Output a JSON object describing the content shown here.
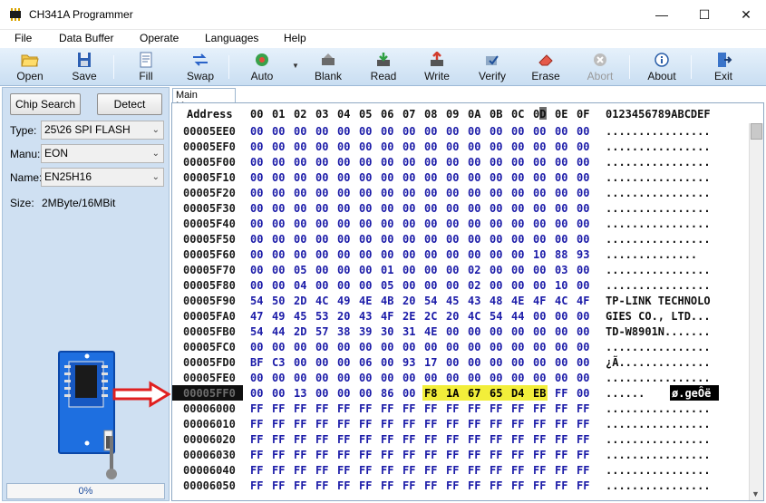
{
  "window": {
    "title": "CH341A Programmer",
    "minimize_glyph": "—",
    "maximize_glyph": "☐",
    "close_glyph": "✕"
  },
  "menu": [
    "File",
    "Data Buffer",
    "Operate",
    "Languages",
    "Help"
  ],
  "toolbar": {
    "open": "Open",
    "save": "Save",
    "fill": "Fill",
    "swap": "Swap",
    "auto": "Auto",
    "blank": "Blank",
    "read": "Read",
    "write": "Write",
    "verify": "Verify",
    "erase": "Erase",
    "abort": "Abort",
    "about": "About",
    "exit": "Exit",
    "dropdown_glyph": "▼"
  },
  "chip_panel": {
    "chip_search": "Chip Search",
    "detect": "Detect",
    "type_label": "Type:",
    "type_value": "25\\26 SPI FLASH",
    "manu_label": "Manu:",
    "manu_value": "EON",
    "name_label": "Name:",
    "name_value": "EN25H16",
    "size_label": "Size:",
    "size_value": "2MByte/16MBit",
    "progress": "0%",
    "combo_arrow": "⌄"
  },
  "memory": {
    "tab": "Main Memory",
    "header_address": "Address",
    "header_cols": [
      "00",
      "01",
      "02",
      "03",
      "04",
      "05",
      "06",
      "07",
      "08",
      "09",
      "0A",
      "0B",
      "0C",
      "0D",
      "0E",
      "0F"
    ],
    "header_ascii": "0123456789ABCDEF",
    "selected_highlight_ascii": "ø.geÔë",
    "rows": [
      {
        "addr": "00005EE0",
        "bytes": [
          "00",
          "00",
          "00",
          "00",
          "00",
          "00",
          "00",
          "00",
          "00",
          "00",
          "00",
          "00",
          "00",
          "00",
          "00",
          "00"
        ],
        "ascii": "................"
      },
      {
        "addr": "00005EF0",
        "bytes": [
          "00",
          "00",
          "00",
          "00",
          "00",
          "00",
          "00",
          "00",
          "00",
          "00",
          "00",
          "00",
          "00",
          "00",
          "00",
          "00"
        ],
        "ascii": "................"
      },
      {
        "addr": "00005F00",
        "bytes": [
          "00",
          "00",
          "00",
          "00",
          "00",
          "00",
          "00",
          "00",
          "00",
          "00",
          "00",
          "00",
          "00",
          "00",
          "00",
          "00"
        ],
        "ascii": "................"
      },
      {
        "addr": "00005F10",
        "bytes": [
          "00",
          "00",
          "00",
          "00",
          "00",
          "00",
          "00",
          "00",
          "00",
          "00",
          "00",
          "00",
          "00",
          "00",
          "00",
          "00"
        ],
        "ascii": "................"
      },
      {
        "addr": "00005F20",
        "bytes": [
          "00",
          "00",
          "00",
          "00",
          "00",
          "00",
          "00",
          "00",
          "00",
          "00",
          "00",
          "00",
          "00",
          "00",
          "00",
          "00"
        ],
        "ascii": "................"
      },
      {
        "addr": "00005F30",
        "bytes": [
          "00",
          "00",
          "00",
          "00",
          "00",
          "00",
          "00",
          "00",
          "00",
          "00",
          "00",
          "00",
          "00",
          "00",
          "00",
          "00"
        ],
        "ascii": "................"
      },
      {
        "addr": "00005F40",
        "bytes": [
          "00",
          "00",
          "00",
          "00",
          "00",
          "00",
          "00",
          "00",
          "00",
          "00",
          "00",
          "00",
          "00",
          "00",
          "00",
          "00"
        ],
        "ascii": "................"
      },
      {
        "addr": "00005F50",
        "bytes": [
          "00",
          "00",
          "00",
          "00",
          "00",
          "00",
          "00",
          "00",
          "00",
          "00",
          "00",
          "00",
          "00",
          "00",
          "00",
          "00"
        ],
        "ascii": "................"
      },
      {
        "addr": "00005F60",
        "bytes": [
          "00",
          "00",
          "00",
          "00",
          "00",
          "00",
          "00",
          "00",
          "00",
          "00",
          "00",
          "00",
          "00",
          "10",
          "88",
          "93"
        ],
        "ascii": "..............  "
      },
      {
        "addr": "00005F70",
        "bytes": [
          "00",
          "00",
          "05",
          "00",
          "00",
          "00",
          "01",
          "00",
          "00",
          "00",
          "02",
          "00",
          "00",
          "00",
          "03",
          "00"
        ],
        "ascii": "................"
      },
      {
        "addr": "00005F80",
        "bytes": [
          "00",
          "00",
          "04",
          "00",
          "00",
          "00",
          "05",
          "00",
          "00",
          "00",
          "02",
          "00",
          "00",
          "00",
          "10",
          "00"
        ],
        "ascii": "................"
      },
      {
        "addr": "00005F90",
        "bytes": [
          "54",
          "50",
          "2D",
          "4C",
          "49",
          "4E",
          "4B",
          "20",
          "54",
          "45",
          "43",
          "48",
          "4E",
          "4F",
          "4C",
          "4F"
        ],
        "ascii": "TP-LINK TECHNOLO"
      },
      {
        "addr": "00005FA0",
        "bytes": [
          "47",
          "49",
          "45",
          "53",
          "20",
          "43",
          "4F",
          "2E",
          "2C",
          "20",
          "4C",
          "54",
          "44",
          "00",
          "00",
          "00"
        ],
        "ascii": "GIES CO., LTD..."
      },
      {
        "addr": "00005FB0",
        "bytes": [
          "54",
          "44",
          "2D",
          "57",
          "38",
          "39",
          "30",
          "31",
          "4E",
          "00",
          "00",
          "00",
          "00",
          "00",
          "00",
          "00"
        ],
        "ascii": "TD-W8901N......."
      },
      {
        "addr": "00005FC0",
        "bytes": [
          "00",
          "00",
          "00",
          "00",
          "00",
          "00",
          "00",
          "00",
          "00",
          "00",
          "00",
          "00",
          "00",
          "00",
          "00",
          "00"
        ],
        "ascii": "................"
      },
      {
        "addr": "00005FD0",
        "bytes": [
          "BF",
          "C3",
          "00",
          "00",
          "00",
          "06",
          "00",
          "93",
          "17",
          "00",
          "00",
          "00",
          "00",
          "00",
          "00",
          "00"
        ],
        "ascii": "¿Ã.............."
      },
      {
        "addr": "00005FE0",
        "bytes": [
          "00",
          "00",
          "00",
          "00",
          "00",
          "00",
          "00",
          "00",
          "00",
          "00",
          "00",
          "00",
          "00",
          "00",
          "00",
          "00"
        ],
        "ascii": "................"
      },
      {
        "addr": "00005FF0",
        "bytes": [
          "00",
          "00",
          "13",
          "00",
          "00",
          "00",
          "86",
          "00",
          "F8",
          "1A",
          "67",
          "65",
          "D4",
          "EB",
          "FF",
          "00"
        ],
        "ascii": "......        .."
      },
      {
        "addr": "00006000",
        "bytes": [
          "FF",
          "FF",
          "FF",
          "FF",
          "FF",
          "FF",
          "FF",
          "FF",
          "FF",
          "FF",
          "FF",
          "FF",
          "FF",
          "FF",
          "FF",
          "FF"
        ],
        "ascii": "................"
      },
      {
        "addr": "00006010",
        "bytes": [
          "FF",
          "FF",
          "FF",
          "FF",
          "FF",
          "FF",
          "FF",
          "FF",
          "FF",
          "FF",
          "FF",
          "FF",
          "FF",
          "FF",
          "FF",
          "FF"
        ],
        "ascii": "................"
      },
      {
        "addr": "00006020",
        "bytes": [
          "FF",
          "FF",
          "FF",
          "FF",
          "FF",
          "FF",
          "FF",
          "FF",
          "FF",
          "FF",
          "FF",
          "FF",
          "FF",
          "FF",
          "FF",
          "FF"
        ],
        "ascii": "................"
      },
      {
        "addr": "00006030",
        "bytes": [
          "FF",
          "FF",
          "FF",
          "FF",
          "FF",
          "FF",
          "FF",
          "FF",
          "FF",
          "FF",
          "FF",
          "FF",
          "FF",
          "FF",
          "FF",
          "FF"
        ],
        "ascii": "................"
      },
      {
        "addr": "00006040",
        "bytes": [
          "FF",
          "FF",
          "FF",
          "FF",
          "FF",
          "FF",
          "FF",
          "FF",
          "FF",
          "FF",
          "FF",
          "FF",
          "FF",
          "FF",
          "FF",
          "FF"
        ],
        "ascii": "................"
      },
      {
        "addr": "00006050",
        "bytes": [
          "FF",
          "FF",
          "FF",
          "FF",
          "FF",
          "FF",
          "FF",
          "FF",
          "FF",
          "FF",
          "FF",
          "FF",
          "FF",
          "FF",
          "FF",
          "FF"
        ],
        "ascii": "................"
      }
    ]
  },
  "colors": {
    "hex_bytes": "#1b1ba8",
    "selection_yellow": "#f2ee3a",
    "toolbar_top": "#e6f1fb",
    "toolbar_bottom": "#c9def2",
    "panel": "#cfe0f2",
    "arrow": "#e02020"
  }
}
